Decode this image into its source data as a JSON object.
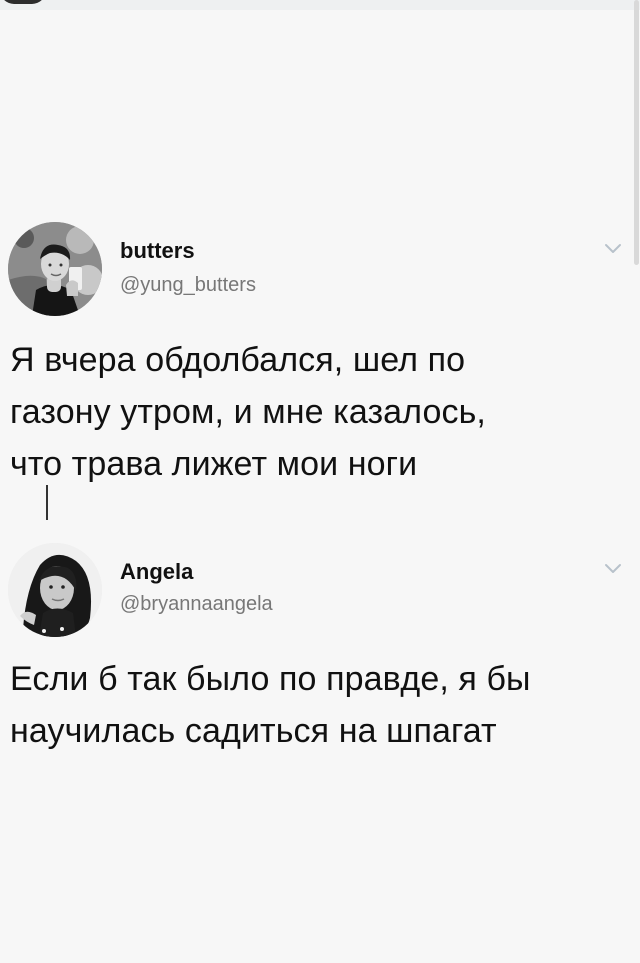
{
  "tweets": [
    {
      "display_name": "butters",
      "handle": "@yung_butters",
      "text_lines": [
        "Я вчера обдолбался, шел по",
        "газону утром, и мне казалось,",
        "что трава лижет мои ноги"
      ],
      "avatar_icon": "profile-photo-icon",
      "menu_icon": "chevron-down-icon"
    },
    {
      "display_name": "Angela",
      "handle": "@bryannaangela",
      "text_lines": [
        "Если б так было по правде, я бы",
        "научилась садиться на шпагат"
      ],
      "avatar_icon": "profile-photo-icon",
      "menu_icon": "chevron-down-icon"
    }
  ],
  "colors": {
    "background": "#f7f7f7",
    "text": "#111111",
    "handle": "#777777",
    "chevron": "#b8c2cb",
    "reply_line": "#333333"
  }
}
